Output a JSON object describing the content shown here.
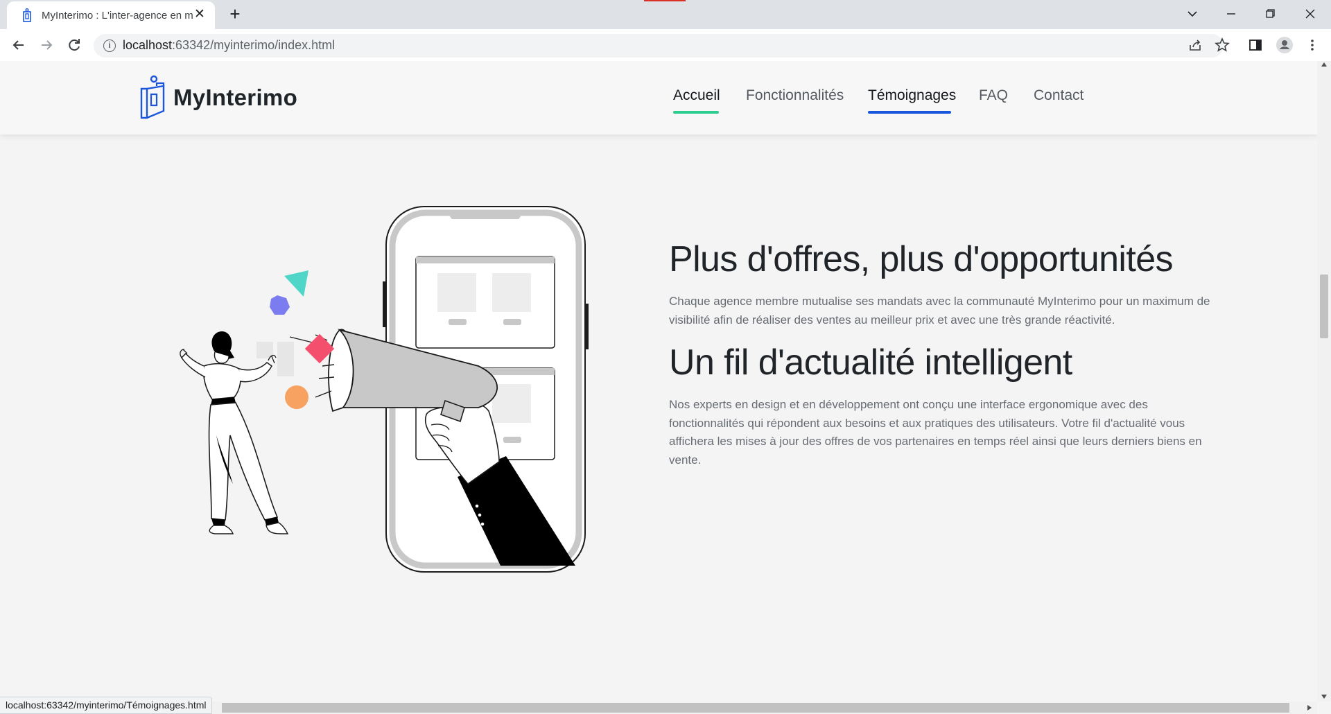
{
  "browser": {
    "tab_title": "MyInterimo : L'inter-agence en m",
    "tab_close_glyph": "✕",
    "new_tab_glyph": "+",
    "url_host": "localhost",
    "url_rest": ":63342/myinterimo/index.html",
    "status_text": "localhost:63342/myinterimo/Témoignages.html"
  },
  "site": {
    "brand": "MyInterimo",
    "nav": [
      {
        "label": "Accueil",
        "state": "active",
        "underline_color": "#2dcc8f"
      },
      {
        "label": "Fonctionnalités",
        "state": "default"
      },
      {
        "label": "Témoignages",
        "state": "hover",
        "underline_color": "#1a56db"
      },
      {
        "label": "FAQ",
        "state": "default"
      },
      {
        "label": "Contact",
        "state": "default"
      }
    ]
  },
  "content": {
    "heading1": "Plus d'offres, plus d'opportunités",
    "text1": "Chaque agence membre mutualise ses mandats avec la communauté MyInterimo pour un maximum de visibilité afin de réaliser des ventes au meilleur prix et avec une très grande réactivité.",
    "heading2": "Un fil d'actualité intelligent",
    "text2": "Nos experts en design et en développement ont conçu une interface ergonomique avec des fonctionnalités qui répondent aux besoins et aux pratiques des utilisateurs. Votre fil d'actualité vous affichera les mises à jour des offres de vos partenaires en temps réel ainsi que leurs derniers biens en vente."
  },
  "colors": {
    "brand_blue": "#1a56db",
    "accent_green": "#2dcc8f",
    "shape_purple": "#7b7cf0",
    "shape_teal": "#4fd6c8",
    "shape_pink": "#f4506e",
    "shape_orange": "#f7a261"
  },
  "icons": [
    "back-arrow-icon",
    "forward-arrow-icon",
    "reload-icon",
    "info-icon",
    "share-icon",
    "star-icon",
    "side-panel-icon",
    "profile-icon",
    "menu-icon"
  ]
}
